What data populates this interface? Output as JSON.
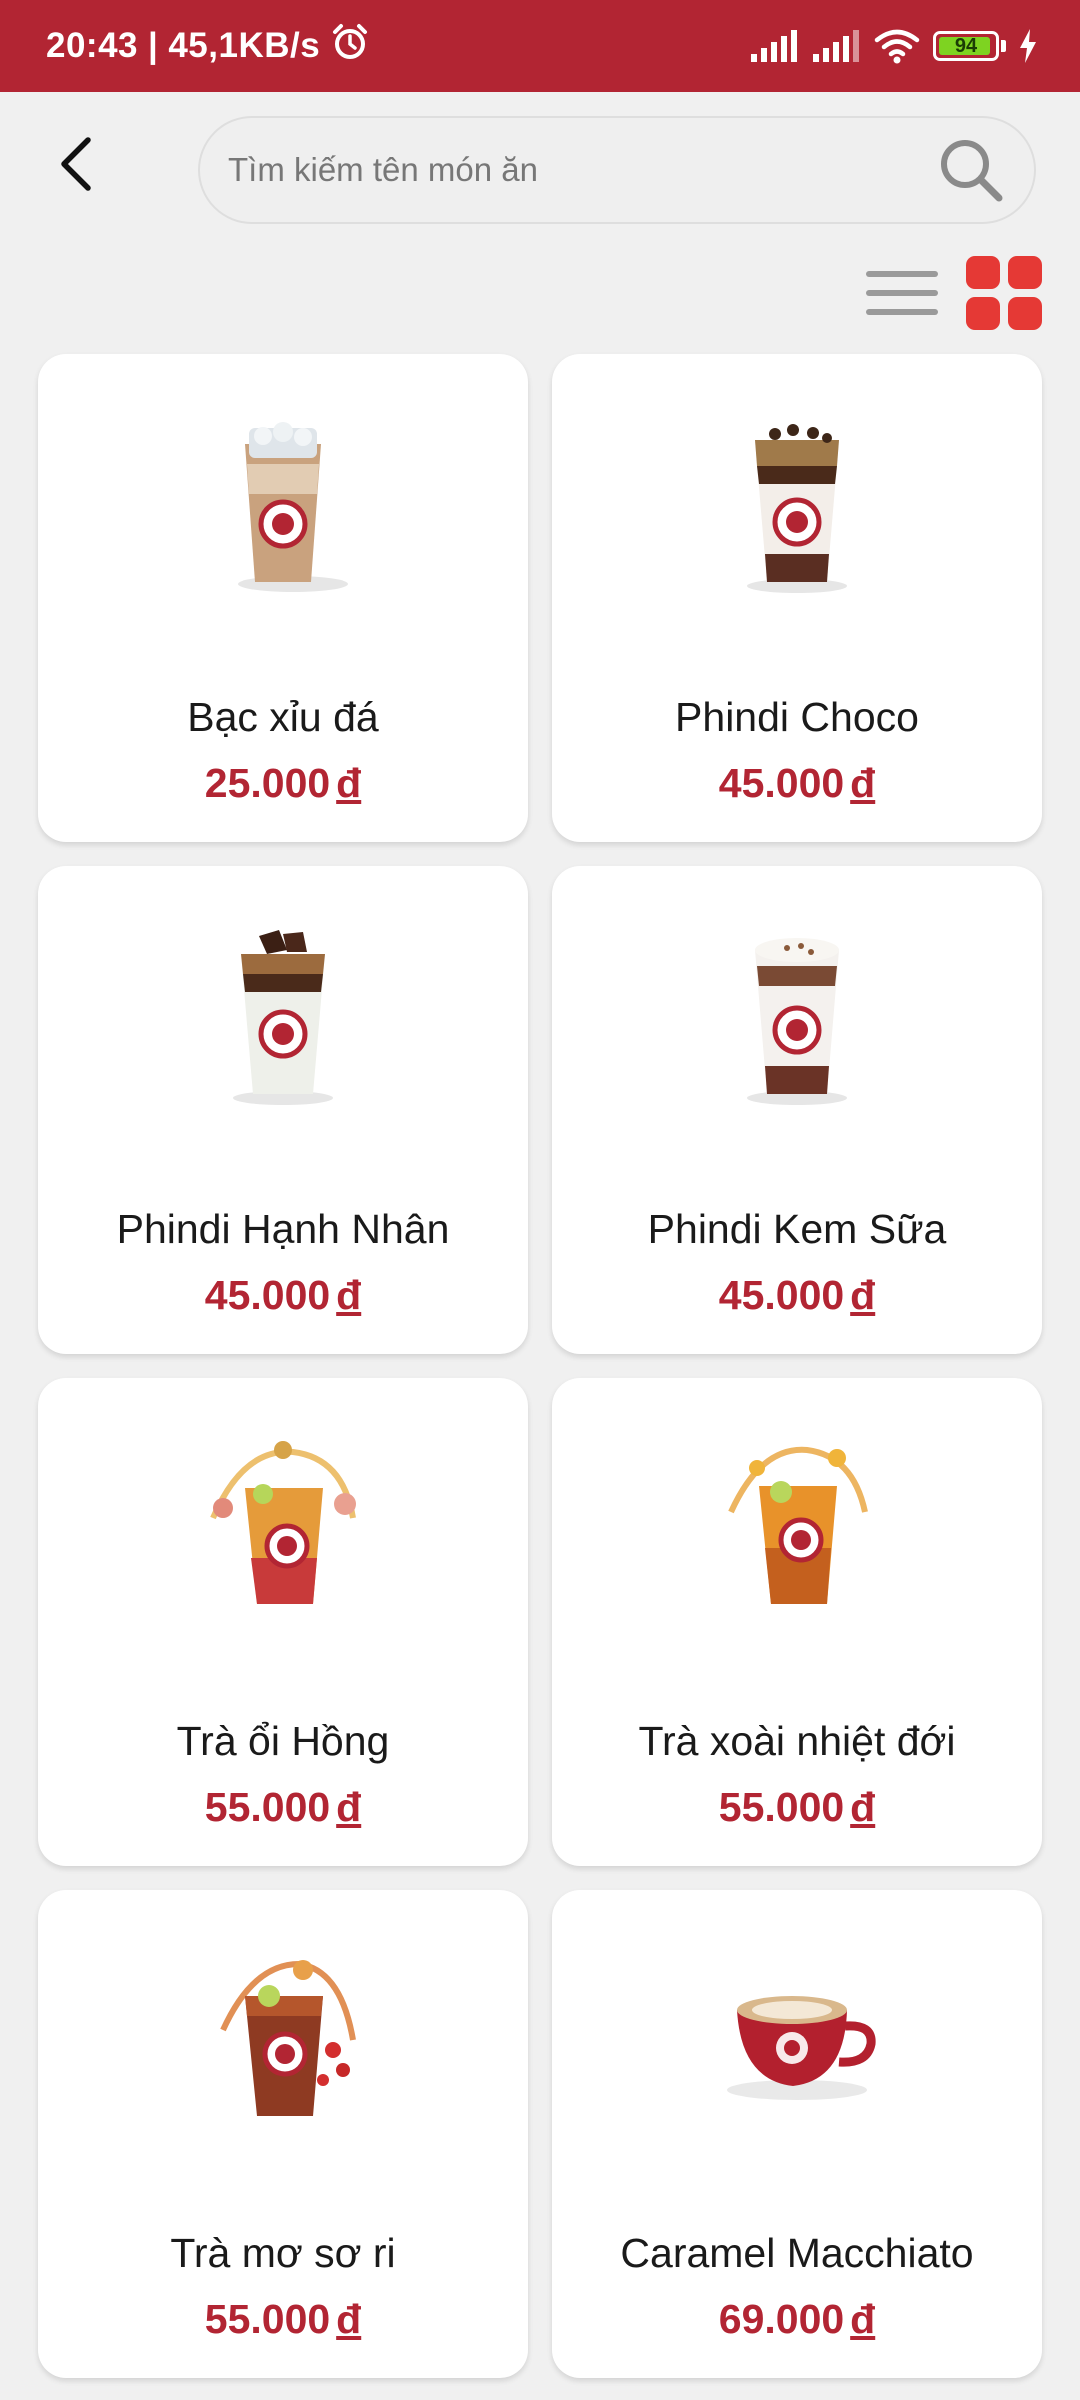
{
  "status_bar": {
    "time": "20:43",
    "separator": "|",
    "speed": "45,1KB/s",
    "battery_level": "94",
    "battery_fraction": 0.94
  },
  "search": {
    "placeholder": "Tìm kiếm tên món ăn",
    "value": ""
  },
  "view_toggle": {
    "active": "grid"
  },
  "colors": {
    "brand": "#b22533",
    "accent": "#e53935",
    "background": "#f0f0f0"
  },
  "products": [
    {
      "name": "Bạc xỉu đá",
      "price": "25.000",
      "currency": "đ",
      "image": "iced-latte-cup"
    },
    {
      "name": "Phindi Choco",
      "price": "45.000",
      "currency": "đ",
      "image": "phindi-choco-cup"
    },
    {
      "name": "Phindi Hạnh Nhân",
      "price": "45.000",
      "currency": "đ",
      "image": "phindi-almond-cup"
    },
    {
      "name": "Phindi Kem Sữa",
      "price": "45.000",
      "currency": "đ",
      "image": "phindi-cream-cup"
    },
    {
      "name": "Trà ổi Hồng",
      "price": "55.000",
      "currency": "đ",
      "image": "guava-tea-cup"
    },
    {
      "name": "Trà xoài nhiệt đới",
      "price": "55.000",
      "currency": "đ",
      "image": "mango-tea-cup"
    },
    {
      "name": "Trà mơ sơ ri",
      "price": "55.000",
      "currency": "đ",
      "image": "apricot-cherry-tea-cup"
    },
    {
      "name": "Caramel Macchiato",
      "price": "69.000",
      "currency": "đ",
      "image": "macchiato-mug"
    }
  ]
}
